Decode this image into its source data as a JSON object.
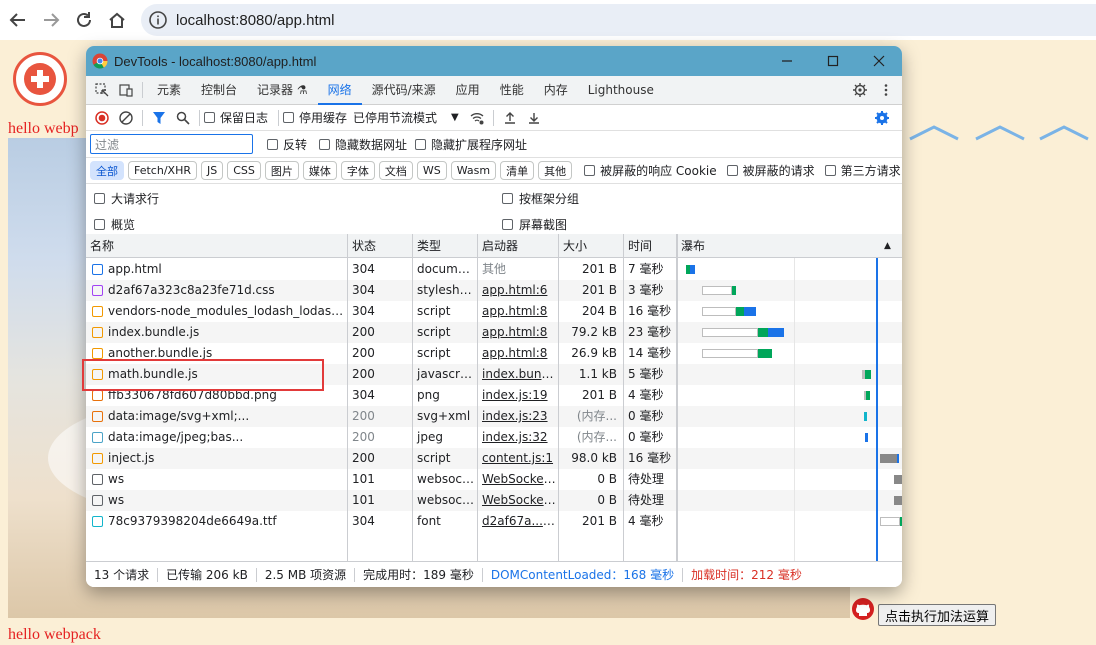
{
  "browser": {
    "url": "localhost:8080/app.html"
  },
  "page": {
    "hello_top": "hello webp",
    "hello_bottom": "hello webpack",
    "add_button": "点击执行加法运算"
  },
  "devtools": {
    "title": "DevTools - localhost:8080/app.html",
    "tabs": [
      {
        "label": "元素",
        "active": false
      },
      {
        "label": "控制台",
        "active": false
      },
      {
        "label": "记录器 ⚗",
        "active": false
      },
      {
        "label": "网络",
        "active": true
      },
      {
        "label": "源代码/来源",
        "active": false
      },
      {
        "label": "应用",
        "active": false
      },
      {
        "label": "性能",
        "active": false
      },
      {
        "label": "内存",
        "active": false
      },
      {
        "label": "Lighthouse",
        "active": false
      }
    ],
    "toolbar": {
      "preserve_log": "保留日志",
      "disable_cache": "停用缓存",
      "throttle": "已停用节流模式"
    },
    "filter": {
      "placeholder": "过滤",
      "invert": "反转",
      "hide_data_urls": "隐藏数据网址",
      "hide_ext_urls": "隐藏扩展程序网址"
    },
    "types": [
      {
        "label": "全部",
        "active": true
      },
      {
        "label": "Fetch/XHR",
        "active": false
      },
      {
        "label": "JS",
        "active": false
      },
      {
        "label": "CSS",
        "active": false
      },
      {
        "label": "图片",
        "active": false
      },
      {
        "label": "媒体",
        "active": false
      },
      {
        "label": "字体",
        "active": false
      },
      {
        "label": "文档",
        "active": false
      },
      {
        "label": "WS",
        "active": false
      },
      {
        "label": "Wasm",
        "active": false
      },
      {
        "label": "清单",
        "active": false
      },
      {
        "label": "其他",
        "active": false
      }
    ],
    "type_options": {
      "blocked_cookies": "被屏蔽的响应 Cookie",
      "blocked_requests": "被屏蔽的请求",
      "third_party": "第三方请求"
    },
    "options": {
      "big_rows": "大请求行",
      "group_by_frame": "按框架分组",
      "overview": "概览",
      "screenshots": "屏幕截图"
    },
    "columns": {
      "name": "名称",
      "status": "状态",
      "type": "类型",
      "initiator": "启动器",
      "size": "大小",
      "time": "时间",
      "waterfall": "瀑布"
    },
    "rows": [
      {
        "name": "app.html",
        "status": "304",
        "type": "document",
        "initiator": "其他",
        "initiator_link": false,
        "size": "201 B",
        "time": "7 毫秒",
        "icon": "document-icon",
        "icon_color": "#1a73e8",
        "dim": false
      },
      {
        "name": "d2af67a323c8a23fe71d.css",
        "status": "304",
        "type": "stylesheet",
        "initiator": "app.html:6",
        "initiator_link": true,
        "size": "201 B",
        "time": "3 毫秒",
        "icon": "stylesheet-icon",
        "icon_color": "#a142f4",
        "dim": false
      },
      {
        "name": "vendors-node_modules_lodash_lodash_js-...",
        "status": "304",
        "type": "script",
        "initiator": "app.html:8",
        "initiator_link": true,
        "size": "204 B",
        "time": "16 毫秒",
        "icon": "script-icon",
        "icon_color": "#f29900",
        "dim": false
      },
      {
        "name": "index.bundle.js",
        "status": "200",
        "type": "script",
        "initiator": "app.html:8",
        "initiator_link": true,
        "size": "79.2 kB",
        "time": "23 毫秒",
        "icon": "script-icon",
        "icon_color": "#f29900",
        "dim": false
      },
      {
        "name": "another.bundle.js",
        "status": "200",
        "type": "script",
        "initiator": "app.html:8",
        "initiator_link": true,
        "size": "26.9 kB",
        "time": "14 毫秒",
        "icon": "script-icon",
        "icon_color": "#f29900",
        "dim": false
      },
      {
        "name": "math.bundle.js",
        "status": "200",
        "type": "javascript",
        "initiator": "index.bundl...",
        "initiator_link": true,
        "size": "1.1 kB",
        "time": "5 毫秒",
        "icon": "script-icon",
        "icon_color": "#f29900",
        "dim": false
      },
      {
        "name": "ffb330678fd607d80bbd.png",
        "status": "304",
        "type": "png",
        "initiator": "index.js:19",
        "initiator_link": true,
        "size": "201 B",
        "time": "4 毫秒",
        "icon": "image-icon",
        "icon_color": "#e8710a",
        "dim": false
      },
      {
        "name": "data:image/svg+xml;...",
        "status": "200",
        "type": "svg+xml",
        "initiator": "index.js:23",
        "initiator_link": true,
        "size": "(内存...",
        "time": "0 毫秒",
        "icon": "image-icon",
        "icon_color": "#e8710a",
        "dim": true
      },
      {
        "name": "data:image/jpeg;bas...",
        "status": "200",
        "type": "jpeg",
        "initiator": "index.js:32",
        "initiator_link": true,
        "size": "(内存...",
        "time": "0 毫秒",
        "icon": "image-icon",
        "icon_color": "#4ba3c7",
        "dim": true
      },
      {
        "name": "inject.js",
        "status": "200",
        "type": "script",
        "initiator": "content.js:1",
        "initiator_link": true,
        "size": "98.0 kB",
        "time": "16 毫秒",
        "icon": "script-icon",
        "icon_color": "#f29900",
        "dim": false
      },
      {
        "name": "ws",
        "status": "101",
        "type": "websocket",
        "initiator": "WebSocket...",
        "initiator_link": true,
        "size": "0 B",
        "time": "待处理",
        "icon": "websocket-icon",
        "icon_color": "#5f6368",
        "dim": false
      },
      {
        "name": "ws",
        "status": "101",
        "type": "websocket",
        "initiator": "WebSocket...",
        "initiator_link": true,
        "size": "0 B",
        "time": "待处理",
        "icon": "websocket-icon",
        "icon_color": "#5f6368",
        "dim": false
      },
      {
        "name": "78c9379398204de6649a.ttf",
        "status": "304",
        "type": "font",
        "initiator": "d2af67a....css",
        "initiator_link": true,
        "size": "201 B",
        "time": "4 毫秒",
        "icon": "font-icon",
        "icon_color": "#12b5cb",
        "dim": false
      }
    ],
    "status_bar": {
      "requests": "13 个请求",
      "transferred": "已传输 206 kB",
      "resources": "2.5 MB 项资源",
      "finish": "完成用时：189 毫秒",
      "dom_loaded": "DOMContentLoaded：168 毫秒",
      "load": "加载时间：212 毫秒",
      "dom_color": "#1a73e8",
      "load_color": "#d93025"
    }
  }
}
